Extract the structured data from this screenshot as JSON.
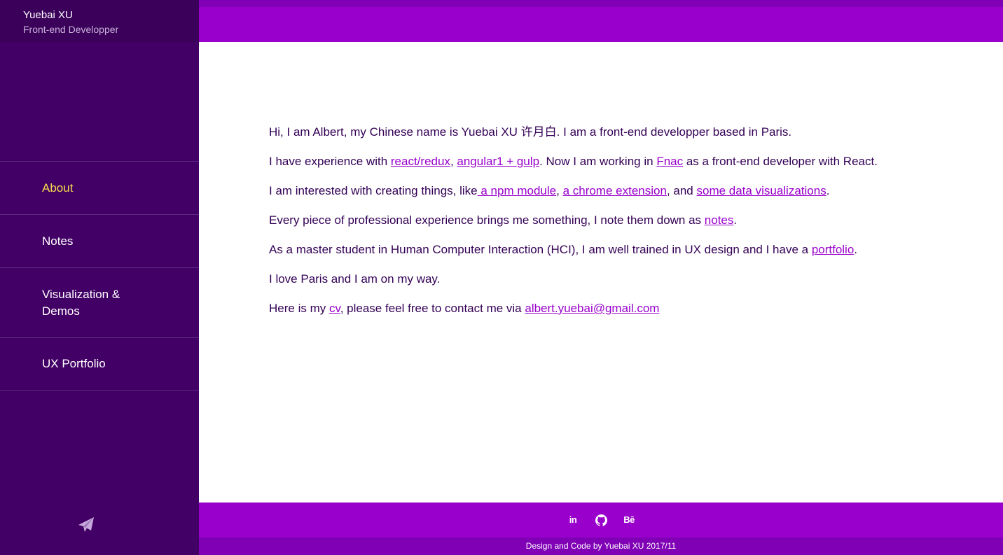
{
  "brand": {
    "name": "Yuebai XU",
    "role": "Front-end Developper"
  },
  "nav": {
    "items": [
      {
        "label": "About"
      },
      {
        "label": "Notes"
      },
      {
        "label": "Visualization & Demos"
      },
      {
        "label": "UX Portfolio"
      }
    ],
    "active_index": 0
  },
  "content": {
    "p1": "Hi, I am Albert, my Chinese name is Yuebai XU 许月白. I am a front-end developper based in Paris.",
    "p2": {
      "t1": "I have experience with ",
      "link1": "react/redux",
      "t2": ", ",
      "link2": "angular1 + gulp",
      "t3": ". Now I am working in ",
      "link3": "Fnac",
      "t4": " as a front-end developer with React."
    },
    "p3": {
      "t1": "I am interested with creating things, like",
      "link1": " a npm module",
      "t2": ", ",
      "link2": "a chrome extension",
      "t3": ", and ",
      "link3": "some data visualizations",
      "t4": "."
    },
    "p4": {
      "t1": "Every piece of professional experience brings me something, I note them down as ",
      "link1": "notes",
      "t2": "."
    },
    "p5": {
      "t1": "As a master student in Human Computer Interaction (HCI), I am well trained in UX design and I have a ",
      "link1": "portfolio",
      "t2": "."
    },
    "p6": "I love Paris and I am on my way.",
    "p7": {
      "t1": "Here is my ",
      "link1": "cv",
      "t2": ", please feel free to contact me via ",
      "link2": "albert.yuebai@gmail.com"
    }
  },
  "footer": {
    "linkedin_text": "in",
    "behance_text": "Bē",
    "credit": "Design and Code by Yuebai XU 2017/11"
  },
  "icons": {
    "send": "paper-plane-icon",
    "linkedin": "linkedin-icon",
    "github": "github-icon",
    "behance": "behance-icon"
  },
  "colors": {
    "sidebar": "#420066",
    "accent": "#9900cc",
    "active_nav": "#f5dc4a",
    "text": "#330055"
  }
}
